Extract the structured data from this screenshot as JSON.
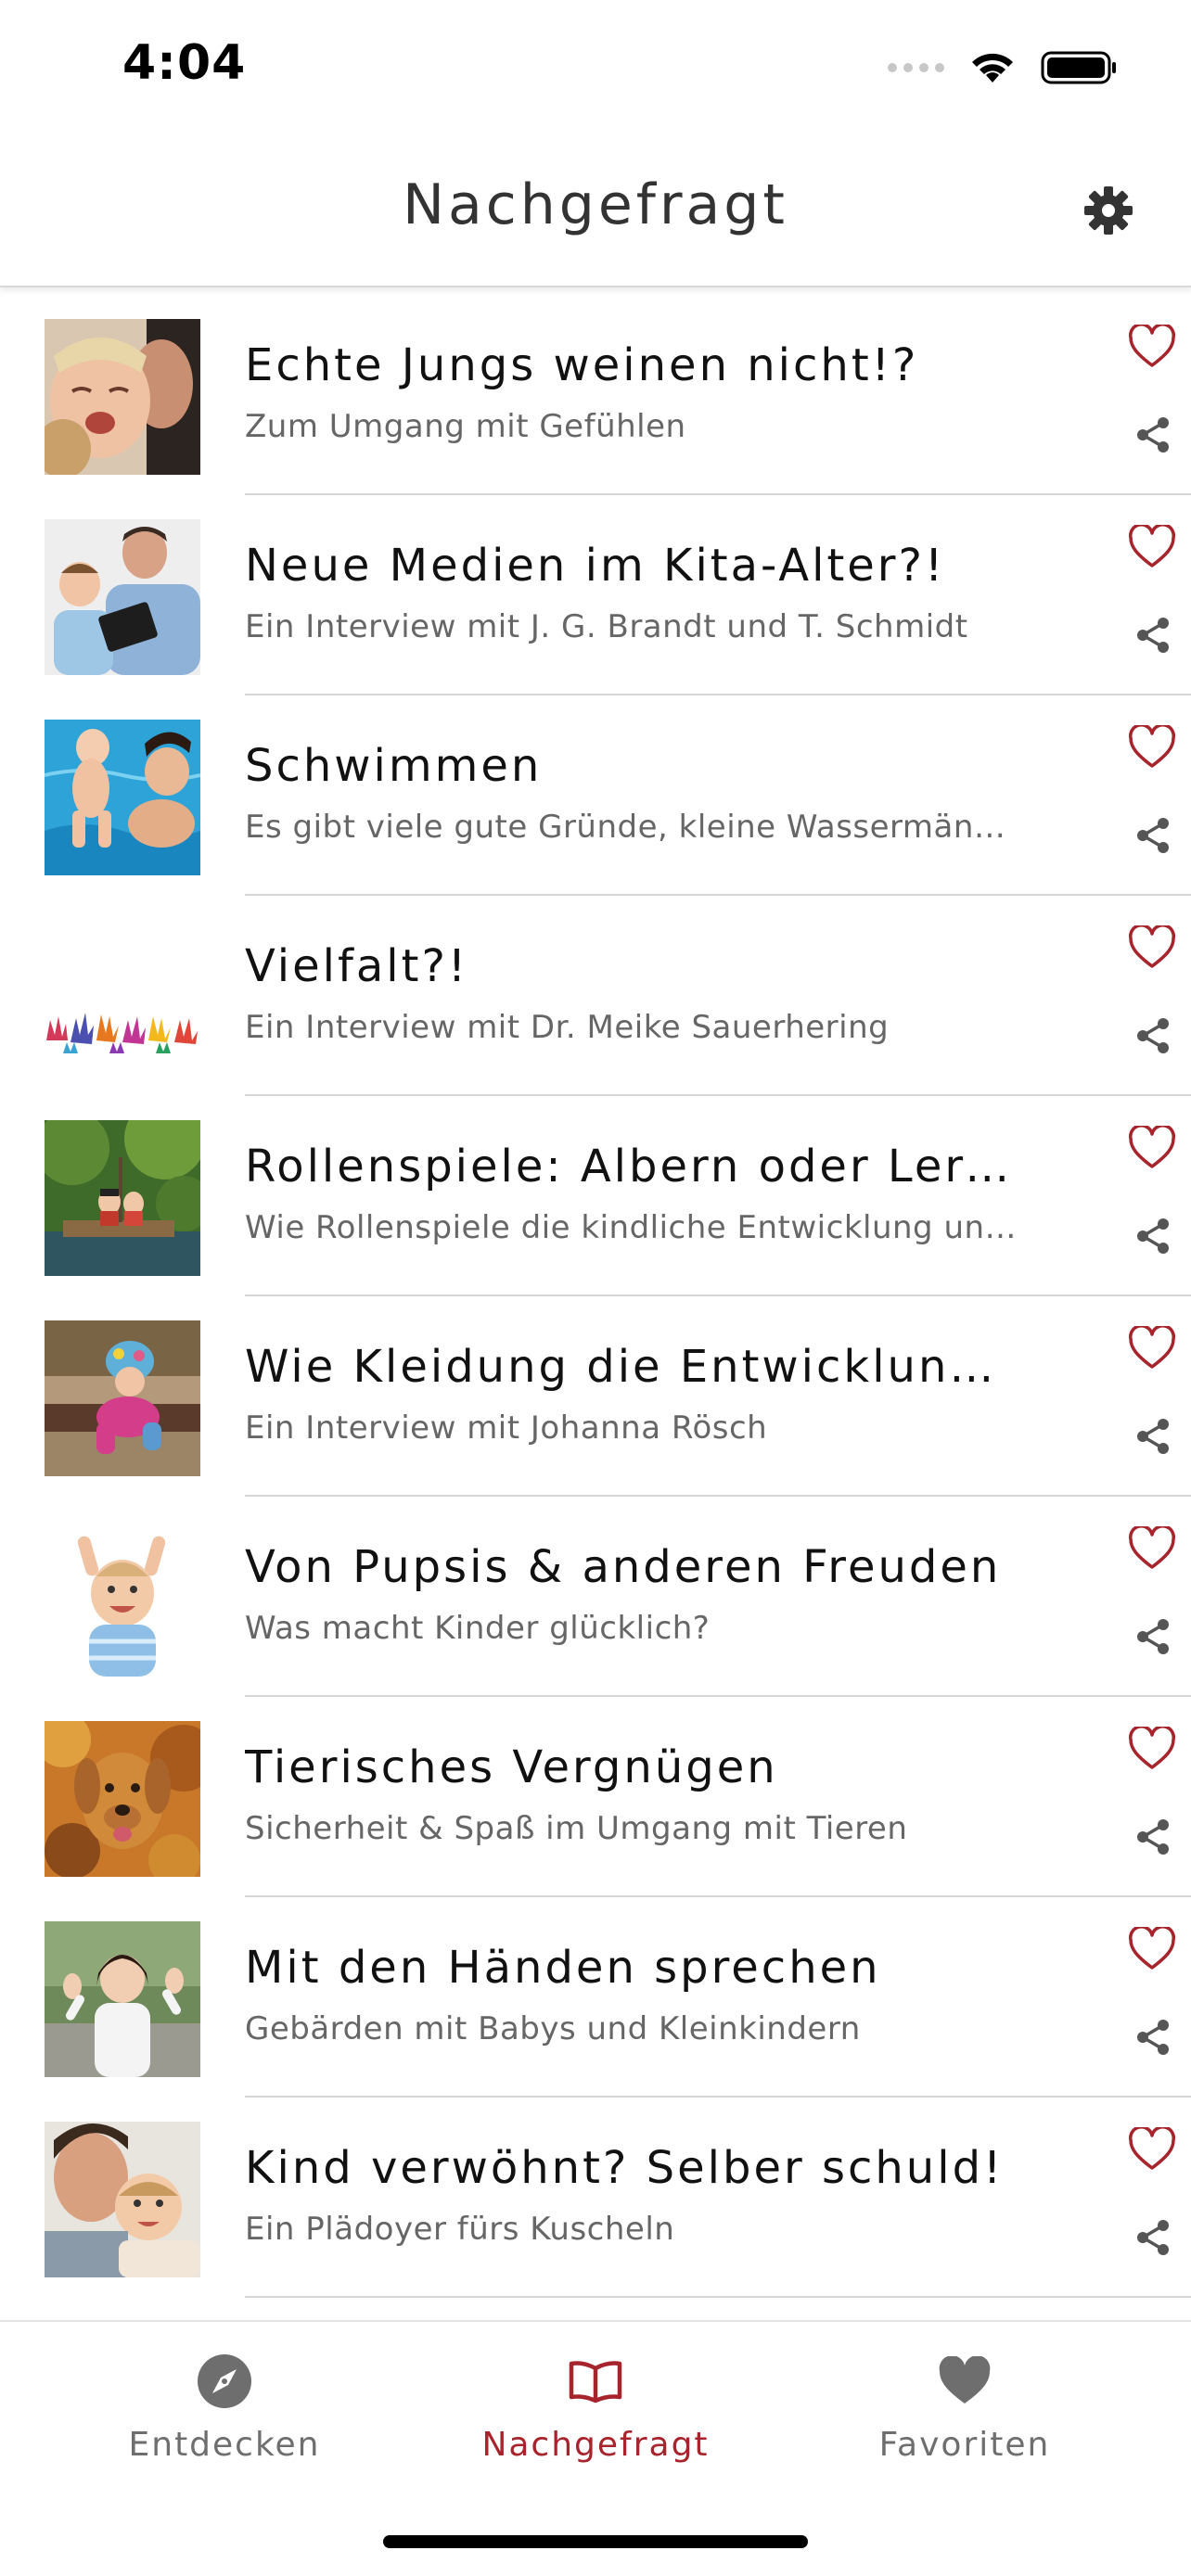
{
  "status_bar": {
    "time": "4:04"
  },
  "header": {
    "title": "Nachgefragt"
  },
  "colors": {
    "accent": "#a8242c",
    "heart": "#a8242c",
    "inactive": "#6e6e6e",
    "subtitle": "#666666"
  },
  "items": [
    {
      "title": "Echte Jungs weinen nicht!?",
      "subtitle": "Zum Umgang mit Gefühlen",
      "icon": "crying-child-photo"
    },
    {
      "title": "Neue Medien im Kita-Alter?!",
      "subtitle": "Ein Interview mit J. G. Brandt und T. Schmidt",
      "icon": "father-tablet-photo"
    },
    {
      "title": "Schwimmen",
      "subtitle": "Es gibt viele gute Gründe, kleine Wassermänner …",
      "icon": "swimming-photo"
    },
    {
      "title": "Vielfalt?!",
      "subtitle": "Ein Interview mit Dr. Meike Sauerhering",
      "icon": "colorful-hands-photo"
    },
    {
      "title": "Rollenspiele: Albern oder Lerner…",
      "subtitle": "Wie Rollenspiele die kindliche Entwicklung unter…",
      "icon": "pirate-raft-photo"
    },
    {
      "title": "Wie Kleidung die Entwicklung u…",
      "subtitle": "Ein Interview mit Johanna Rösch",
      "icon": "toddler-crawling-photo"
    },
    {
      "title": "Von Pupsis & anderen Freuden",
      "subtitle": "Was macht Kinder glücklich?",
      "icon": "happy-baby-photo"
    },
    {
      "title": "Tierisches Vergnügen",
      "subtitle": "Sicherheit & Spaß im Umgang mit Tieren",
      "icon": "dog-leaves-photo"
    },
    {
      "title": "Mit den Händen sprechen",
      "subtitle": "Gebärden mit Babys und Kleinkindern",
      "icon": "girl-signing-photo"
    },
    {
      "title": "Kind verwöhnt? Selber schuld!",
      "subtitle": "Ein Plädoyer fürs Kuscheln",
      "icon": "father-kiss-photo"
    }
  ],
  "tabs": [
    {
      "label": "Entdecken",
      "icon": "compass-icon",
      "active": false
    },
    {
      "label": "Nachgefragt",
      "icon": "book-icon",
      "active": true
    },
    {
      "label": "Favoriten",
      "icon": "heart-icon",
      "active": false
    }
  ]
}
